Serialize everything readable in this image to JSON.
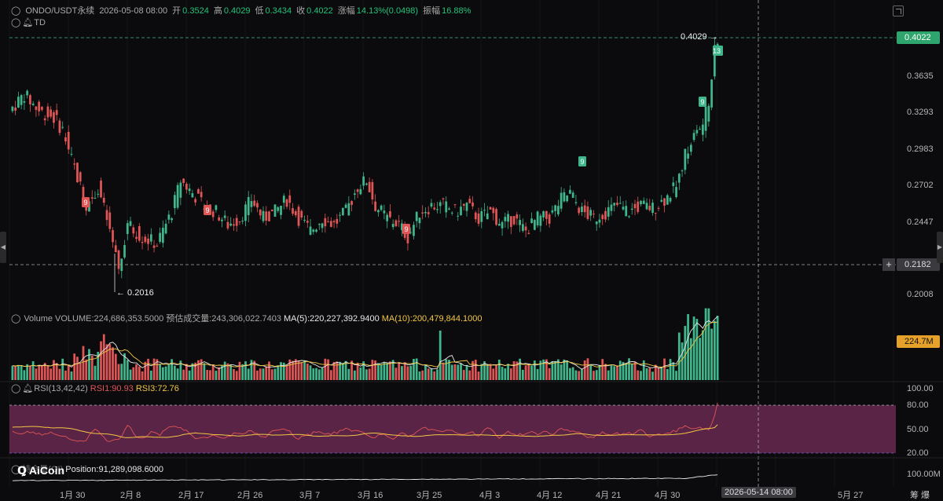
{
  "header": {
    "symbol": "ONDO/USDT永续",
    "datetime": "2026-05-08 08:00",
    "open_label": "开",
    "open": "0.3524",
    "high_label": "高",
    "high": "0.4029",
    "low_label": "低",
    "low": "0.3434",
    "close_label": "收",
    "close": "0.4022",
    "change_label": "涨幅",
    "change": "14.13%(0.0498)",
    "amp_label": "振幅",
    "amp": "16.88%",
    "indicator": "TD"
  },
  "price_axis": [
    "0.3635",
    "0.3293",
    "0.2983",
    "0.2702",
    "0.2447",
    "0.2008"
  ],
  "price_tags": {
    "current": "0.4022",
    "cursor": "0.2182"
  },
  "annotations": {
    "high_marker": "0.4029",
    "low_marker": "← 0.2016",
    "td_high": "13",
    "td_9": "9"
  },
  "volume": {
    "label": "Volume",
    "value": "VOLUME:224,686,353.5000",
    "estimate": "预估成交量:243,306,022.7403",
    "ma5": "MA(5):220,227,392.9400",
    "ma10": "MA(10):200,479,844.1000",
    "tag": "224.7M"
  },
  "rsi": {
    "label": "RSI(13,42,42)",
    "rsi1": "RSI1:90.93",
    "rsi3": "RSI3:72.76",
    "axis": [
      "100.00",
      "80.00",
      "50.00",
      "20.00"
    ]
  },
  "position": {
    "label": "持仓量(OI)",
    "value": "Position:91,289,098.6000",
    "axis": "100.00M"
  },
  "logo": "AiCoin",
  "dates": [
    "1月 30",
    "2月 8",
    "2月 17",
    "2月 26",
    "3月 7",
    "3月 16",
    "3月 25",
    "4月 3",
    "4月 12",
    "4月 21",
    "4月 30"
  ],
  "cursor_date": "2026-05-14 08:00",
  "future_dates": [
    "5月 27"
  ],
  "right_bottom": "筹 爆",
  "colors": {
    "up": "#3fb68b",
    "down": "#e05555",
    "bg": "#0b0b0d",
    "rsi_band": "#5a2446",
    "yellow": "#f2c744"
  }
}
